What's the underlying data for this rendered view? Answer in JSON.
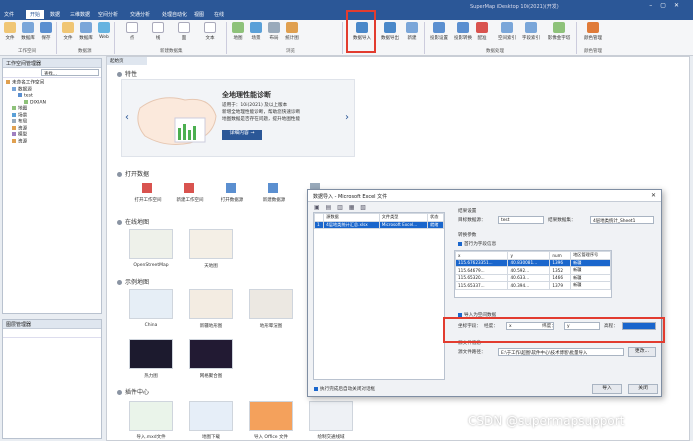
{
  "titlebar": {
    "tabs": [
      "文件",
      "开始",
      "数据",
      "三维数据",
      "空间分析",
      "交通分析",
      "处理自动化",
      "视图",
      "在线"
    ],
    "app_title": "SuperMap iDesktop 10i(2021)(开发)"
  },
  "ribbon": {
    "buttons": [
      "文件",
      "数据库",
      "保存",
      "文件",
      "数据库",
      "Web",
      "点",
      "线",
      "面",
      "文本",
      "地图",
      "场景",
      "布局",
      "统计图",
      "数据导入",
      "数据导出",
      "新建",
      "投影设置",
      "投影转换",
      "配准",
      "空间索引",
      "字段索引",
      "影像金字塔",
      "颜色管理"
    ],
    "groups": [
      "工作空间",
      "数据源",
      "新建数据集",
      "浏览",
      "数据处理",
      "颜色管理"
    ]
  },
  "workspace_manager": {
    "title": "工作空间管理器",
    "search_placeholder": "查找...",
    "tree": [
      "未命名工作空间",
      "数据源",
      "test",
      "DIXIAN",
      "地图",
      "场景",
      "布局",
      "资源",
      "模型",
      "资源"
    ]
  },
  "layer_manager": {
    "title": "图层管理器"
  },
  "main": {
    "tab": "起始页",
    "banner": {
      "title": "全地理性能诊断",
      "text1": "适用于：10i(2021) 及以上版本",
      "text2": "新增全地理性能诊断，帮助您快速诊断",
      "text3": "地图数据是否存在问题，提升地图性能",
      "button": "详细内容 →"
    },
    "sections": {
      "features": "特性",
      "open_data": "打开数据",
      "online_map": "在线地图",
      "example_map": "示例地图",
      "plugin_center": "插件中心"
    },
    "open_items": [
      "打开工作空间",
      "新建工作空间",
      "打开数据源",
      "新建数据源",
      "打开文件",
      "新建"
    ],
    "online_items": [
      "OpenStreetMap",
      "天地图"
    ],
    "example_items": [
      "China",
      "新疆地形图",
      "地形晕渲图",
      "热力图",
      "网格聚合图"
    ],
    "plugin_items": [
      "导入.mxd文件",
      "地图下载",
      "导入 Office 文件",
      "绘制交通线域"
    ]
  },
  "dialog": {
    "title": "数据导入 - Microsoft Excel 文件",
    "toolbar_note": "",
    "list_headers": [
      "",
      "源数据",
      "文件类型",
      "状态"
    ],
    "list_row": [
      "1",
      "4层地类统计汇总.xlsx",
      "Microsoft Excel...",
      "就绪"
    ],
    "result_settings": "结果设置",
    "target_datasource_label": "目标数据源：",
    "target_datasource_value": "test",
    "result_dataset_label": "结果数据集：",
    "result_dataset_value": "4层地类统计_Sheet1",
    "conversion_params": "转换参数",
    "first_row_header": "首行为字段信息",
    "table_headers": [
      "x",
      "y",
      "num",
      "地区管理序号"
    ],
    "table_rows": [
      [
        "115.67623351...",
        "40.830081...",
        "1396",
        "新疆"
      ],
      [
        "115.64679...",
        "40.592...",
        "1352",
        "新疆"
      ],
      [
        "115.65320...",
        "40.633...",
        "1466",
        "新疆"
      ],
      [
        "115.65337...",
        "40.394...",
        "1379",
        "新疆"
      ]
    ],
    "import_spatial_data": "导入为空间数据",
    "coord_field_label": "坐标字段：",
    "lon_label": "经度：",
    "lon_value": "x",
    "lat_label": "纬度：",
    "lat_value": "y",
    "elev_label": "高程：",
    "elev_value": "",
    "source_info": "源文件信息",
    "source_path_label": "源文件路径：",
    "source_path_value": "E:\\于工作\\超图\\软件中心\\技术博客\\批量导入",
    "browse_button": "更改...",
    "auto_close_label": "执行完成后自动关闭对话框",
    "import_button": "导入",
    "close_button": "关闭"
  },
  "watermark": "CSDN @supermapsupport",
  "colors": {
    "title_blue": "#2b5797",
    "highlight_red": "#e23c2f",
    "select_blue": "#1a66cc"
  }
}
